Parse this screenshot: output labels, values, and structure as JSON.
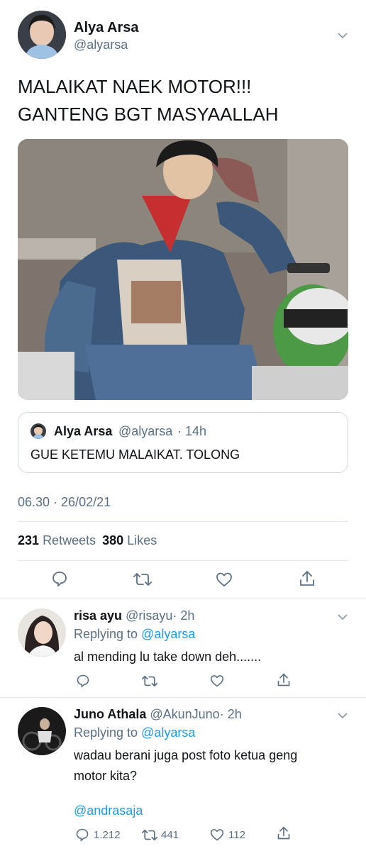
{
  "tweet": {
    "display_name": "Alya Arsa",
    "handle": "@alyarsa",
    "text_line1": "MALAIKAT NAEK MOTOR!!!",
    "text_line2": "GANTENG BGT MASYAALLAH",
    "quoted": {
      "display_name": "Alya Arsa",
      "handle": "@alyarsa",
      "time": "· 14h",
      "text": "GUE KETEMU MALAIKAT. TOLONG"
    },
    "timestamp": "06.30 · 26/02/21",
    "retweet_count": "231",
    "retweet_label": "Retweets",
    "like_count": "380",
    "like_label": "Likes"
  },
  "replies": [
    {
      "display_name": "risa ayu",
      "handle": "@risayu",
      "time": "· 2h",
      "replying_label": "Replying to",
      "replying_to": "@alyarsa",
      "text": "al mending lu take down deh.......",
      "reply_count": "",
      "retweet_count": "",
      "like_count": ""
    },
    {
      "display_name": "Juno Athala",
      "handle": "@AkunJuno",
      "time": "· 2h",
      "replying_label": "Replying to",
      "replying_to": "@alyarsa",
      "text_line1": "wadau berani juga post foto ketua geng",
      "text_line2": "motor kita?",
      "mention": "@andrasaja",
      "reply_count": "1.212",
      "retweet_count": "441",
      "like_count": "112"
    }
  ],
  "colors": {
    "accent": "#1d9bf0",
    "secondary_text": "#5b7083",
    "divider": "#e1e8ed"
  },
  "icons": [
    "chevron-down-icon",
    "reply-icon",
    "retweet-icon",
    "like-icon",
    "share-icon"
  ]
}
